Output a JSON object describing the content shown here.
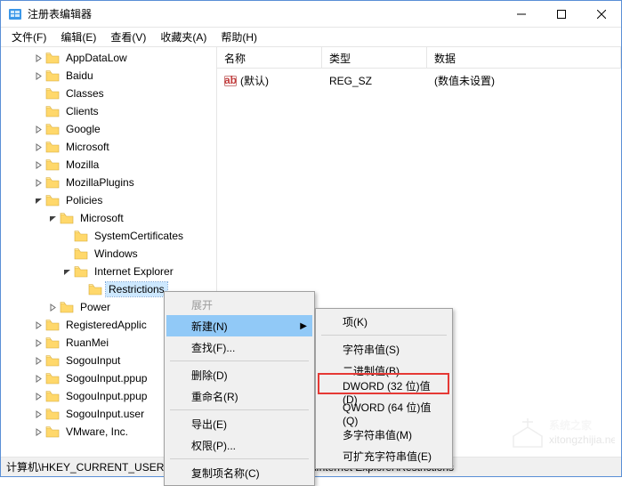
{
  "window": {
    "title": "注册表编辑器"
  },
  "menubar": {
    "file": "文件(F)",
    "edit": "编辑(E)",
    "view": "查看(V)",
    "favorites": "收藏夹(A)",
    "help": "帮助(H)"
  },
  "tree": {
    "items": [
      {
        "indent": 2,
        "exp": "closed",
        "label": "AppDataLow"
      },
      {
        "indent": 2,
        "exp": "closed",
        "label": "Baidu"
      },
      {
        "indent": 2,
        "exp": "none",
        "label": "Classes"
      },
      {
        "indent": 2,
        "exp": "none",
        "label": "Clients"
      },
      {
        "indent": 2,
        "exp": "closed",
        "label": "Google"
      },
      {
        "indent": 2,
        "exp": "closed",
        "label": "Microsoft"
      },
      {
        "indent": 2,
        "exp": "closed",
        "label": "Mozilla"
      },
      {
        "indent": 2,
        "exp": "closed",
        "label": "MozillaPlugins"
      },
      {
        "indent": 2,
        "exp": "open",
        "label": "Policies"
      },
      {
        "indent": 3,
        "exp": "open",
        "label": "Microsoft"
      },
      {
        "indent": 4,
        "exp": "none",
        "label": "SystemCertificates"
      },
      {
        "indent": 4,
        "exp": "none",
        "label": "Windows"
      },
      {
        "indent": 4,
        "exp": "open",
        "label": "Internet Explorer"
      },
      {
        "indent": 5,
        "exp": "none",
        "label": "Restrictions",
        "selected": true
      },
      {
        "indent": 3,
        "exp": "closed",
        "label": "Power"
      },
      {
        "indent": 2,
        "exp": "closed",
        "label": "RegisteredApplic"
      },
      {
        "indent": 2,
        "exp": "closed",
        "label": "RuanMei"
      },
      {
        "indent": 2,
        "exp": "closed",
        "label": "SogouInput"
      },
      {
        "indent": 2,
        "exp": "closed",
        "label": "SogouInput.ppup"
      },
      {
        "indent": 2,
        "exp": "closed",
        "label": "SogouInput.ppup"
      },
      {
        "indent": 2,
        "exp": "closed",
        "label": "SogouInput.user"
      },
      {
        "indent": 2,
        "exp": "closed",
        "label": "VMware, Inc."
      }
    ]
  },
  "columns": {
    "name": "名称",
    "type": "类型",
    "data": "数据"
  },
  "rows": [
    {
      "icon": "ab",
      "name": "(默认)",
      "type": "REG_SZ",
      "data": "(数值未设置)"
    }
  ],
  "context_menu_1": {
    "expand": "展开",
    "new": "新建(N)",
    "find": "查找(F)...",
    "delete": "删除(D)",
    "rename": "重命名(R)",
    "export": "导出(E)",
    "permissions": "权限(P)...",
    "copy_key_name": "复制项名称(C)"
  },
  "context_menu_2": {
    "key": "项(K)",
    "string": "字符串值(S)",
    "binary": "二进制值(B)",
    "dword": "DWORD (32 位)值(D)",
    "qword": "QWORD (64 位)值(Q)",
    "multi_string": "多字符串值(M)",
    "expandable_string": "可扩充字符串值(E)"
  },
  "statusbar": {
    "path": "计算机\\HKEY_CURRENT_USER\\SOFTWARE\\Policies\\Microsoft\\Internet Explorer\\Restrictions"
  },
  "watermark": {
    "line1": "系统之家",
    "line2": "xitongzhijia.net"
  }
}
